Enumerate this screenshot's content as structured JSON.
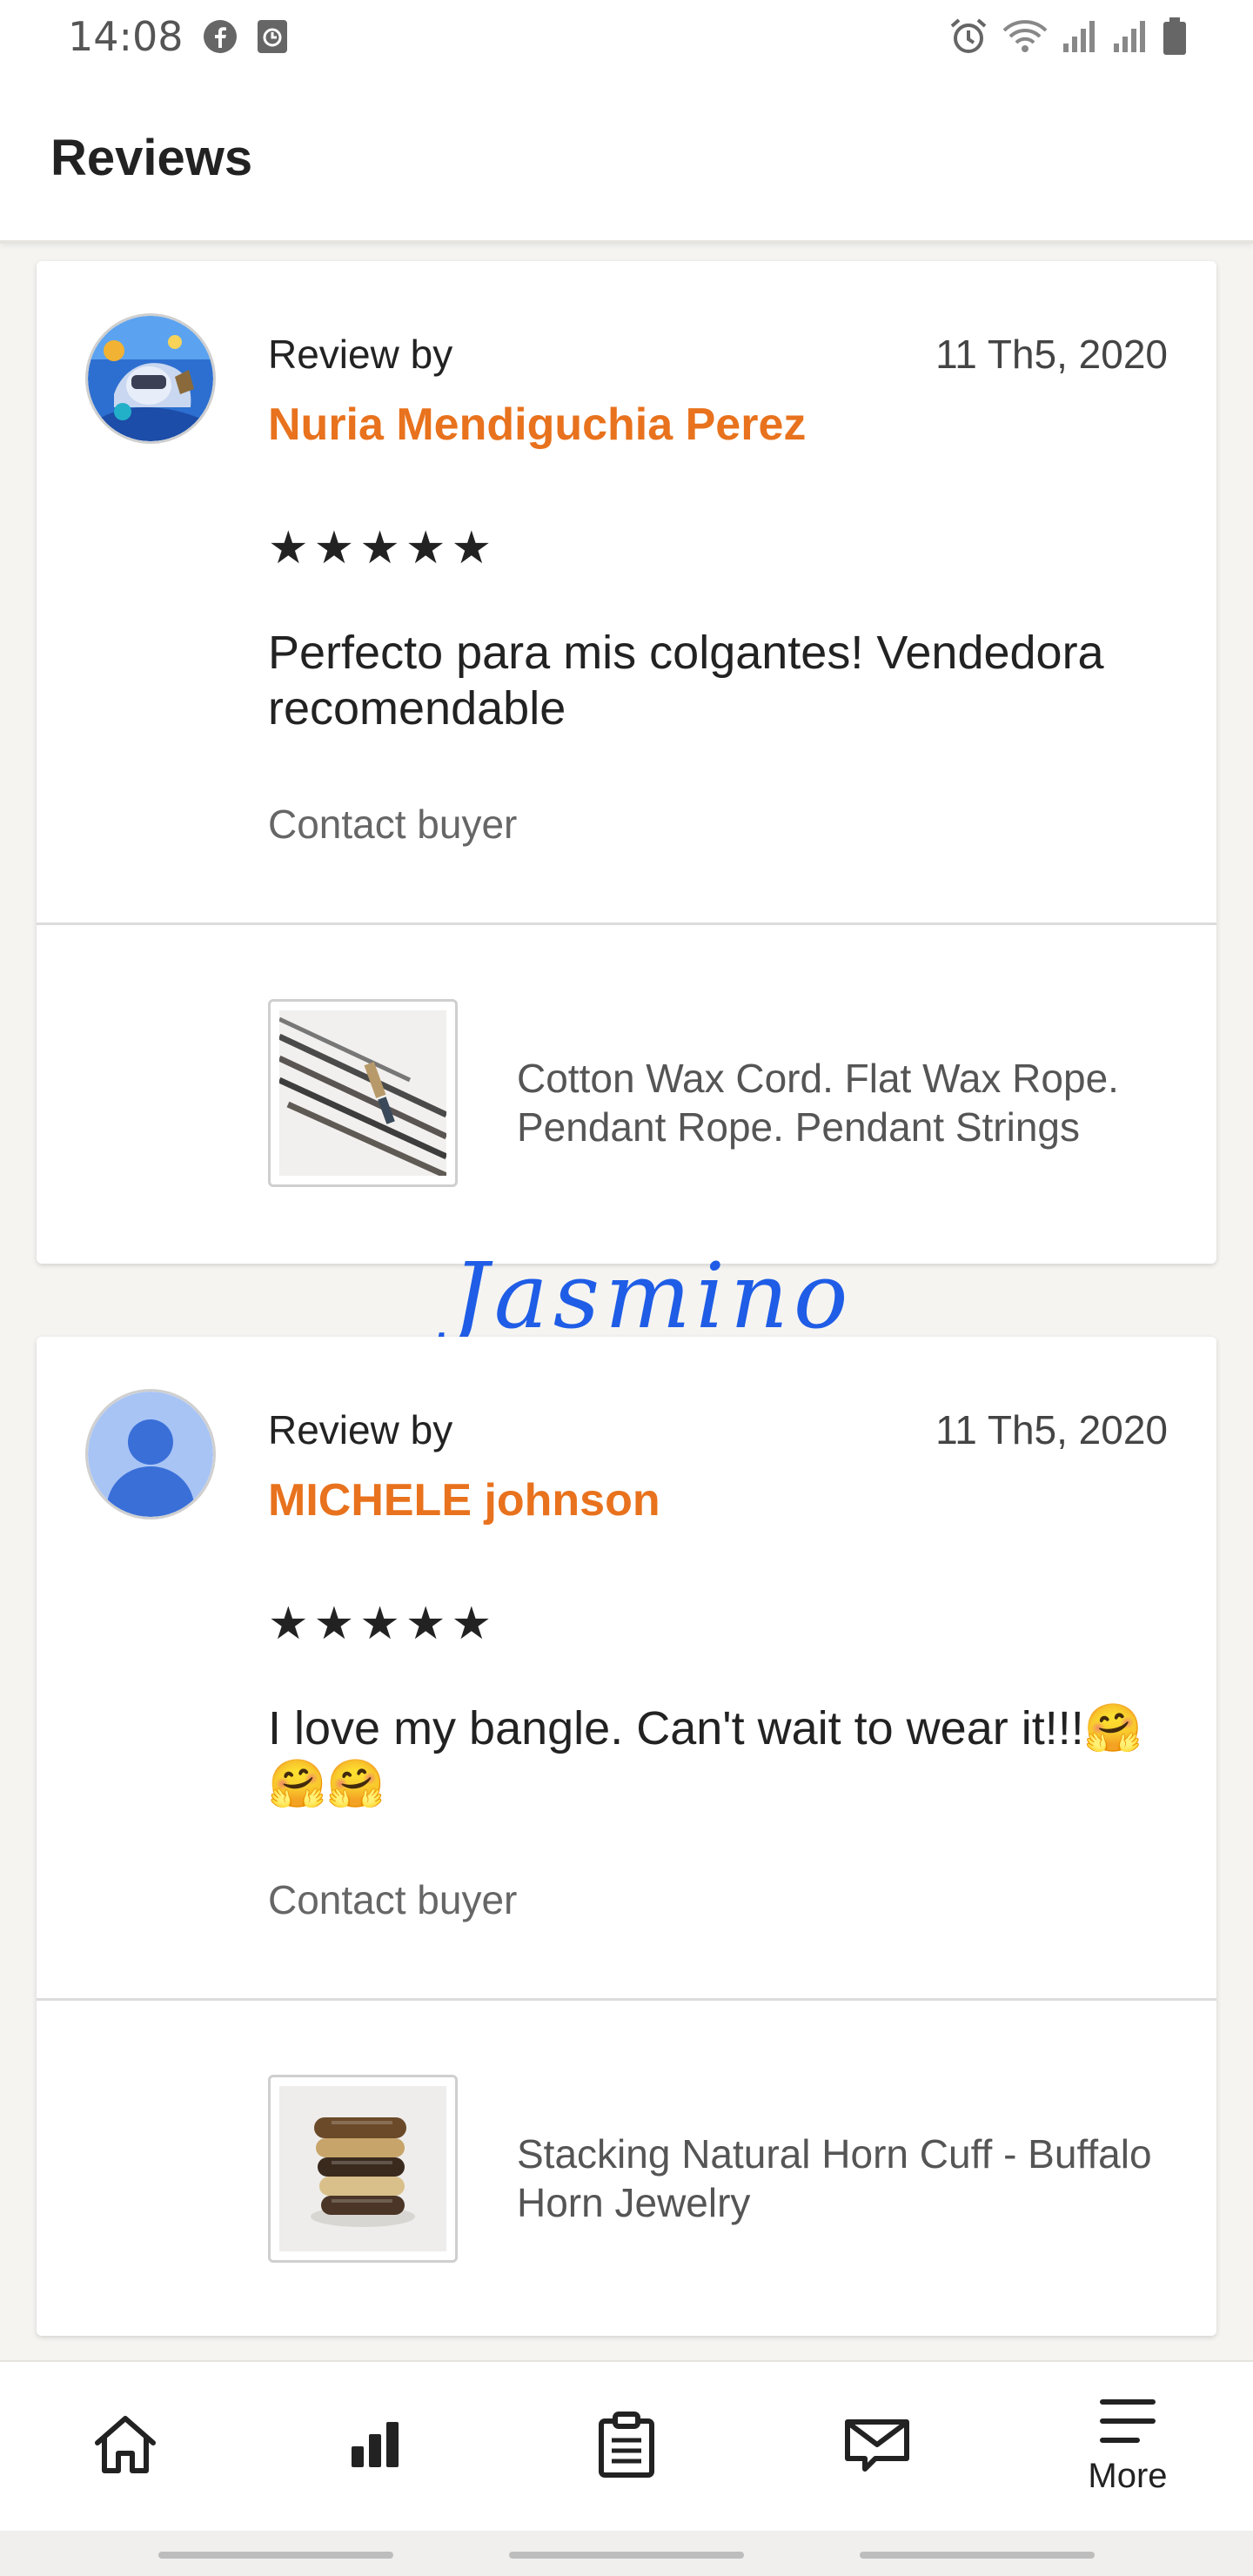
{
  "status_bar": {
    "time": "14:08",
    "left_icons": [
      "facebook-icon",
      "clock-app-icon"
    ],
    "right_icons": [
      "alarm-icon",
      "wifi-icon",
      "signal-icon",
      "signal-icon",
      "battery-icon"
    ]
  },
  "header": {
    "title": "Reviews"
  },
  "reviews": [
    {
      "review_by": "Review by",
      "reviewer": "Nuria Mendiguchia Perez",
      "date": "11 Th5, 2020",
      "rating": 5,
      "stars": "★★★★★",
      "text": "Perfecto para mis colgantes! Vendedora recomendable",
      "contact_label": "Contact buyer",
      "product_title": "Cotton Wax Cord. Flat Wax Rope. Pendant Rope. Pendant Strings"
    },
    {
      "review_by": "Review by",
      "reviewer": "MICHELE johnson",
      "date": "11 Th5, 2020",
      "rating": 5,
      "stars": "★★★★★",
      "text": "I love my bangle. Can't wait to wear it!!!🤗🤗🤗",
      "contact_label": "Contact buyer",
      "product_title": "Stacking Natural Horn Cuff - Buffalo Horn Jewelry"
    }
  ],
  "watermark": "Jasmino",
  "bottom_nav": {
    "items": [
      {
        "icon": "home-icon"
      },
      {
        "icon": "stats-icon"
      },
      {
        "icon": "orders-clipboard-icon"
      },
      {
        "icon": "messages-icon"
      },
      {
        "icon": "menu-icon",
        "label": "More"
      }
    ]
  },
  "colors": {
    "accent": "#e8721d",
    "background": "#f5f4f1",
    "watermark": "#1f5de6"
  }
}
